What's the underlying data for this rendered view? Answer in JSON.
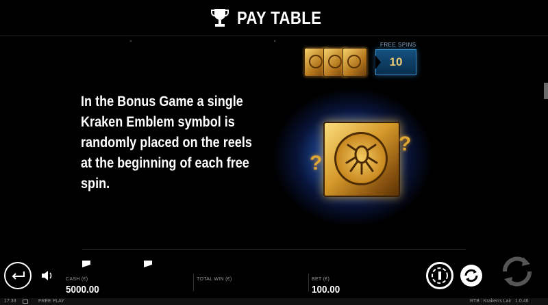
{
  "header": {
    "title": "PAY TABLE",
    "icon": "trophy-icon"
  },
  "description": {
    "lines": [
      "In the Bonus Game a single",
      "Kraken Emblem symbol is",
      "randomly placed on the reels",
      "at the beginning of each free",
      "spin."
    ]
  },
  "free_spins": {
    "label": "FREE SPINS",
    "value": "10"
  },
  "emblem": {
    "name": "kraken-emblem",
    "marks": [
      "?",
      "?"
    ]
  },
  "balance": {
    "cash_label": "CASH (€)",
    "cash_value": "5000.00",
    "total_win_label": "TOTAL WIN (€)",
    "total_win_value": "",
    "bet_label": "BET (€)",
    "bet_value": "100.00"
  },
  "footer": {
    "time": "17:33",
    "mode": "FREE PLAY",
    "game": "RTB : Kraken's Lair",
    "version": "1.0.46"
  },
  "colors": {
    "background": "#000000",
    "gold": "#d69a2a",
    "glow_blue": "#3c8ec6"
  }
}
